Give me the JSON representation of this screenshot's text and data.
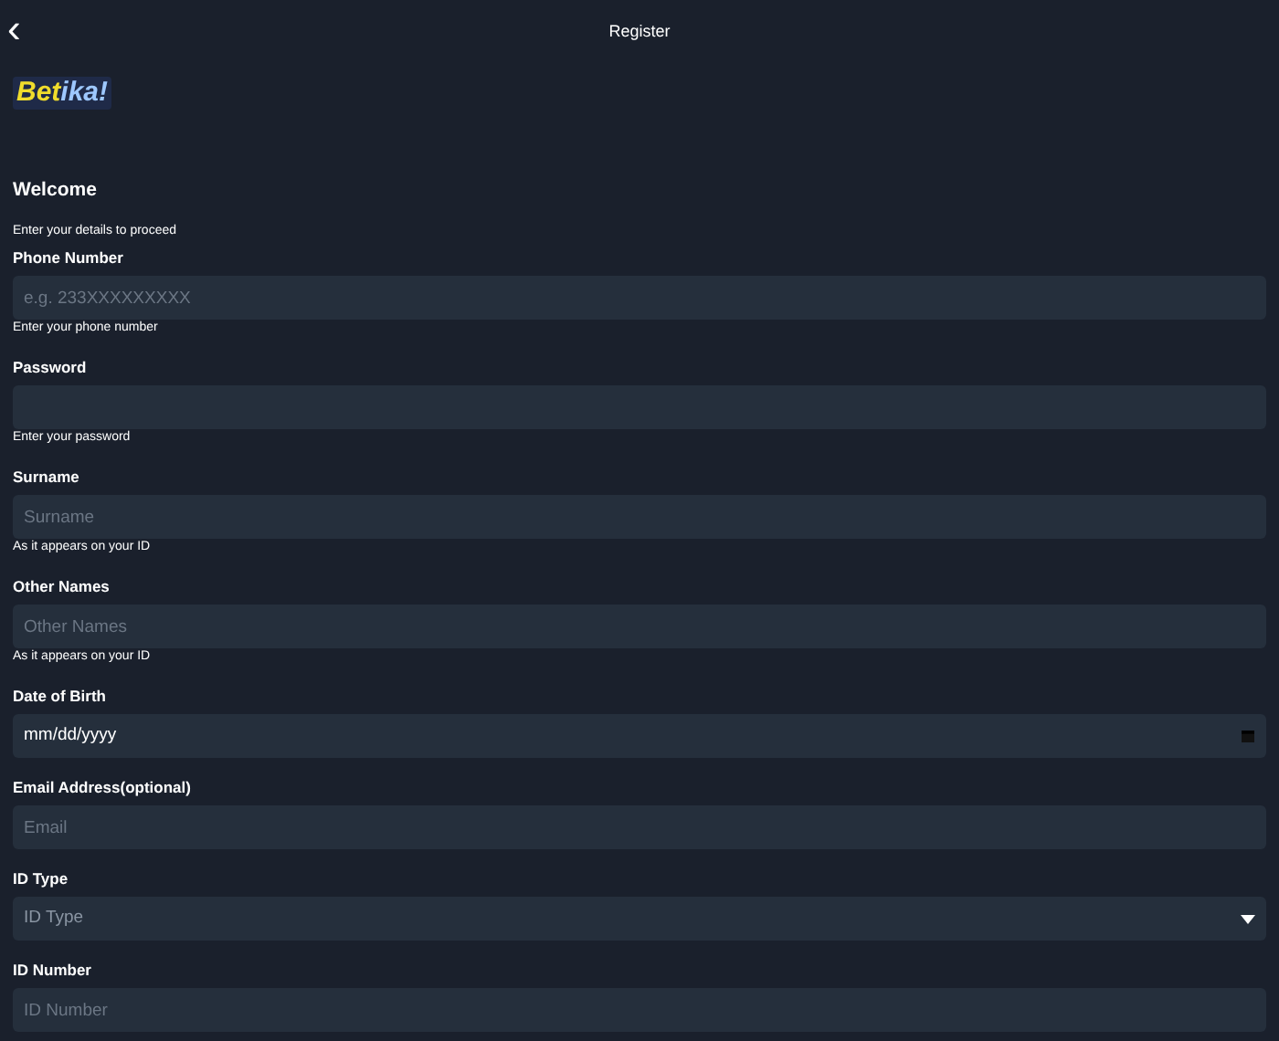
{
  "header": {
    "back": "‹",
    "title": "Register"
  },
  "logo": {
    "part_1": "Bet",
    "part_2": "ika!"
  },
  "heading": "Welcome",
  "subtitle": "Enter your details to proceed",
  "fields": [
    {
      "kind": "text",
      "label": "Phone Number",
      "placeholder": "e.g. 233XXXXXXXXX",
      "hint": "Enter your phone number"
    },
    {
      "kind": "password",
      "label": "Password",
      "hint": "Enter your password"
    },
    {
      "kind": "text",
      "label": "Surname",
      "placeholder": "Surname",
      "hint": "As it appears on your ID"
    },
    {
      "kind": "text",
      "label": "Other Names",
      "placeholder": "Other Names",
      "hint": "As it appears on your ID"
    },
    {
      "kind": "date",
      "label": "Date of Birth",
      "value": "mm/dd/yyyy"
    },
    {
      "kind": "text",
      "label": "Email Address(optional)",
      "placeholder": "Email"
    },
    {
      "kind": "select",
      "label": "ID Type",
      "value": "ID Type"
    },
    {
      "kind": "text",
      "label": "ID Number",
      "placeholder": "ID Number"
    }
  ]
}
